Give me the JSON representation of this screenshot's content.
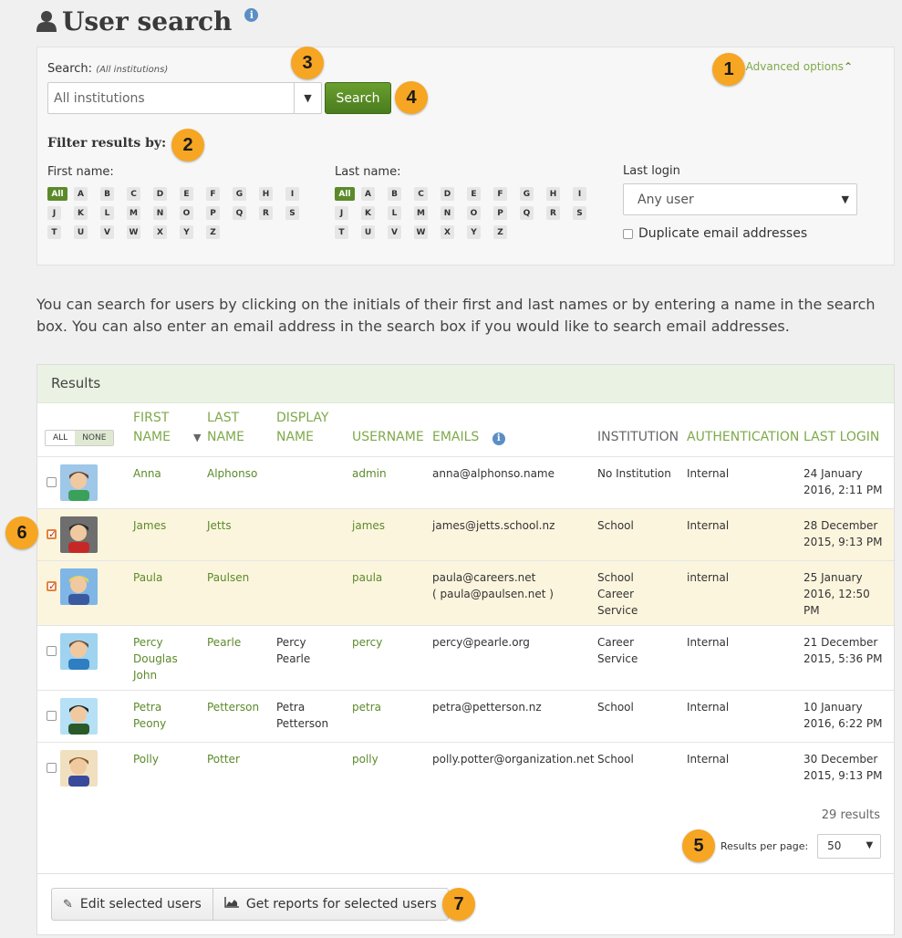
{
  "page": {
    "title": "User search"
  },
  "search": {
    "label": "Search:",
    "scope": "(All institutions)",
    "institution_value": "All institutions",
    "button": "Search",
    "advanced": "Advanced options"
  },
  "filter": {
    "heading": "Filter results by:",
    "first_name_label": "First name:",
    "last_name_label": "Last name:",
    "letters": [
      "All",
      "A",
      "B",
      "C",
      "D",
      "E",
      "F",
      "G",
      "H",
      "I",
      "J",
      "K",
      "L",
      "M",
      "N",
      "O",
      "P",
      "Q",
      "R",
      "S",
      "T",
      "U",
      "V",
      "W",
      "X",
      "Y",
      "Z"
    ],
    "last_login_label": "Last login",
    "last_login_value": "Any user",
    "duplicate_label": "Duplicate email addresses"
  },
  "description": "You can search for users by clicking on the initials of their first and last names or by entering a name in the search box. You can also enter an email address in the search box if you would like to search email addresses.",
  "results": {
    "heading": "Results",
    "toggle_all": "ALL",
    "toggle_none": "NONE",
    "columns": {
      "first_name": [
        "FIRST",
        "NAME"
      ],
      "last_name": [
        "LAST",
        "NAME"
      ],
      "display_name": [
        "DISPLAY",
        "NAME"
      ],
      "username": "USERNAME",
      "emails": "EMAILS",
      "institution": "INSTITUTION",
      "authentication": "AUTHENTICATION",
      "last_login": "LAST LOGIN"
    },
    "rows": [
      {
        "first": "Anna",
        "last": "Alphonso",
        "display": "",
        "username": "admin",
        "email": "anna@alphonso.name",
        "institution": "No Institution",
        "auth": "Internal",
        "login": "24 January 2016, 2:11 PM",
        "checked": false
      },
      {
        "first": "James",
        "last": "Jetts",
        "display": "",
        "username": "james",
        "email": "james@jetts.school.nz",
        "institution": "School",
        "auth": "Internal",
        "login": "28 December 2015, 9:13 PM",
        "checked": true
      },
      {
        "first": "Paula",
        "last": "Paulsen",
        "display": "",
        "username": "paula",
        "email": "paula@careers.net\n( paula@paulsen.net )",
        "institution": "School\nCareer\nService",
        "auth": "internal",
        "login": "25 January 2016, 12:50 PM",
        "checked": true
      },
      {
        "first": "Percy\nDouglas\nJohn",
        "last": "Pearle",
        "display": "Percy\nPearle",
        "username": "percy",
        "email": "percy@pearle.org",
        "institution": "Career\nService",
        "auth": "Internal",
        "login": "21 December 2015, 5:36 PM",
        "checked": false
      },
      {
        "first": "Petra\nPeony",
        "last": "Petterson",
        "display": "Petra\nPetterson",
        "username": "petra",
        "email": "petra@petterson.nz",
        "institution": "School",
        "auth": "Internal",
        "login": "10 January 2016, 6:22 PM",
        "checked": false
      },
      {
        "first": "Polly",
        "last": "Potter",
        "display": "",
        "username": "polly",
        "email": "polly.potter@organization.net",
        "institution": "School",
        "auth": "Internal",
        "login": "30 December 2015, 9:13 PM",
        "checked": false
      }
    ],
    "count": "29 results",
    "per_page_label": "Results per page:",
    "per_page_value": "50",
    "edit_button": "Edit selected users",
    "reports_button": "Get reports for selected users"
  },
  "callouts": [
    "1",
    "2",
    "3",
    "4",
    "5",
    "6",
    "7"
  ],
  "colors": {
    "accent": "#5b8a2a",
    "link": "#7ea94a",
    "callout": "#f6a623",
    "selected_row": "#fcf5de"
  }
}
